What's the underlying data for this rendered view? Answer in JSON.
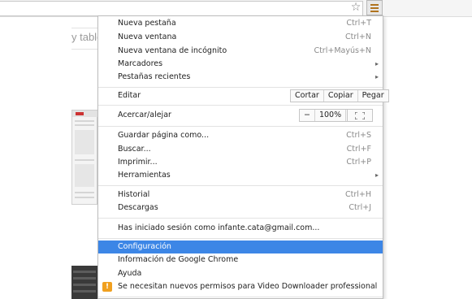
{
  "toolbar": {
    "bookmark_star_icon": "star-icon",
    "menu_icon": "hamburger-menu-icon",
    "accent": "#b0741e"
  },
  "background_page": {
    "partial_text": "y table"
  },
  "menu": {
    "highlight_color": "#3c86e6",
    "items": [
      {
        "label": "Nueva pestaña",
        "shortcut": "Ctrl+T"
      },
      {
        "label": "Nueva ventana",
        "shortcut": "Ctrl+N"
      },
      {
        "label": "Nueva ventana de incógnito",
        "shortcut": "Ctrl+Mayús+N"
      },
      {
        "label": "Marcadores",
        "submenu": "▸"
      },
      {
        "label": "Pestañas recientes",
        "submenu": "▸"
      },
      {
        "label": "Editar",
        "buttons": [
          "Cortar",
          "Copiar",
          "Pegar"
        ]
      },
      {
        "label": "Acercar/alejar",
        "zoom_minus": "−",
        "zoom_value": "100%",
        "zoom_plus": "+",
        "fullscreen_icon": "fullscreen-icon"
      },
      {
        "label": "Guardar página como...",
        "shortcut": "Ctrl+S"
      },
      {
        "label": "Buscar...",
        "shortcut": "Ctrl+F"
      },
      {
        "label": "Imprimir...",
        "shortcut": "Ctrl+P"
      },
      {
        "label": "Herramientas",
        "submenu": "▸"
      },
      {
        "label": "Historial",
        "shortcut": "Ctrl+H"
      },
      {
        "label": "Descargas",
        "shortcut": "Ctrl+J"
      },
      {
        "label": "Has iniciado sesión como infante.cata@gmail.com..."
      },
      {
        "label": "Configuración",
        "highlighted": true
      },
      {
        "label": "Información de Google Chrome"
      },
      {
        "label": "Ayuda"
      },
      {
        "label": "Se necesitan nuevos permisos para Video Downloader professional",
        "warning_icon": "warning-icon",
        "warning_glyph": "!"
      }
    ]
  }
}
